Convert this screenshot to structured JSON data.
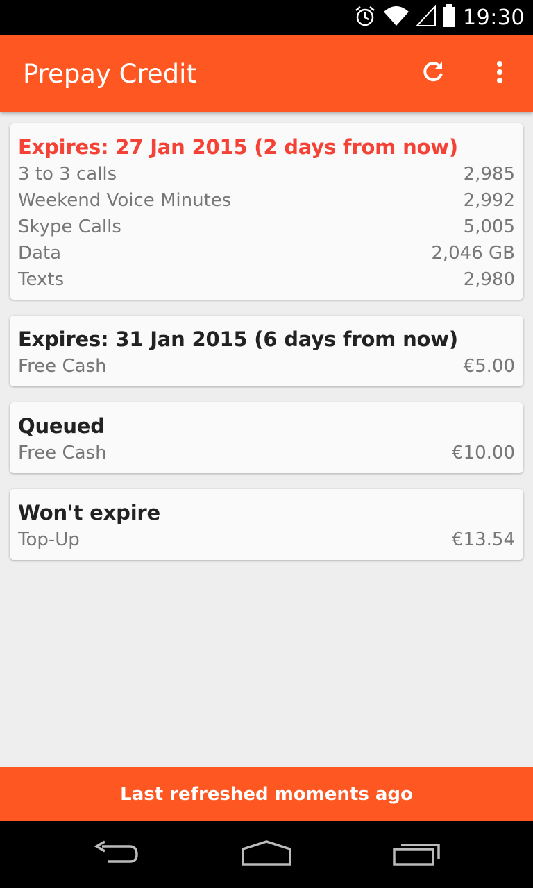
{
  "status_bar": {
    "time": "19:30",
    "icons": [
      "alarm-icon",
      "wifi-icon",
      "signal-icon",
      "battery-icon"
    ]
  },
  "app_bar": {
    "title": "Prepay Credit",
    "actions": [
      "refresh-icon",
      "overflow-menu-icon"
    ],
    "color": "#ff5722"
  },
  "cards": [
    {
      "title": "Expires: 27 Jan 2015 (2 days from now)",
      "title_color": "#f44336",
      "rows": [
        {
          "label": "3 to 3 calls",
          "value": "2,985"
        },
        {
          "label": "Weekend Voice Minutes",
          "value": "2,992"
        },
        {
          "label": "Skype Calls",
          "value": "5,005"
        },
        {
          "label": "Data",
          "value": "2,046 GB"
        },
        {
          "label": "Texts",
          "value": "2,980"
        }
      ]
    },
    {
      "title": "Expires: 31 Jan 2015 (6 days from now)",
      "rows": [
        {
          "label": "Free Cash",
          "value": "€5.00"
        }
      ]
    },
    {
      "title": "Queued",
      "rows": [
        {
          "label": "Free Cash",
          "value": "€10.00"
        }
      ]
    },
    {
      "title": "Won't expire",
      "rows": [
        {
          "label": "Top-Up",
          "value": "€13.54"
        }
      ]
    }
  ],
  "footer": {
    "text": "Last refreshed moments ago"
  },
  "nav_bar": {
    "buttons": [
      "back-icon",
      "home-icon",
      "recents-icon"
    ]
  }
}
